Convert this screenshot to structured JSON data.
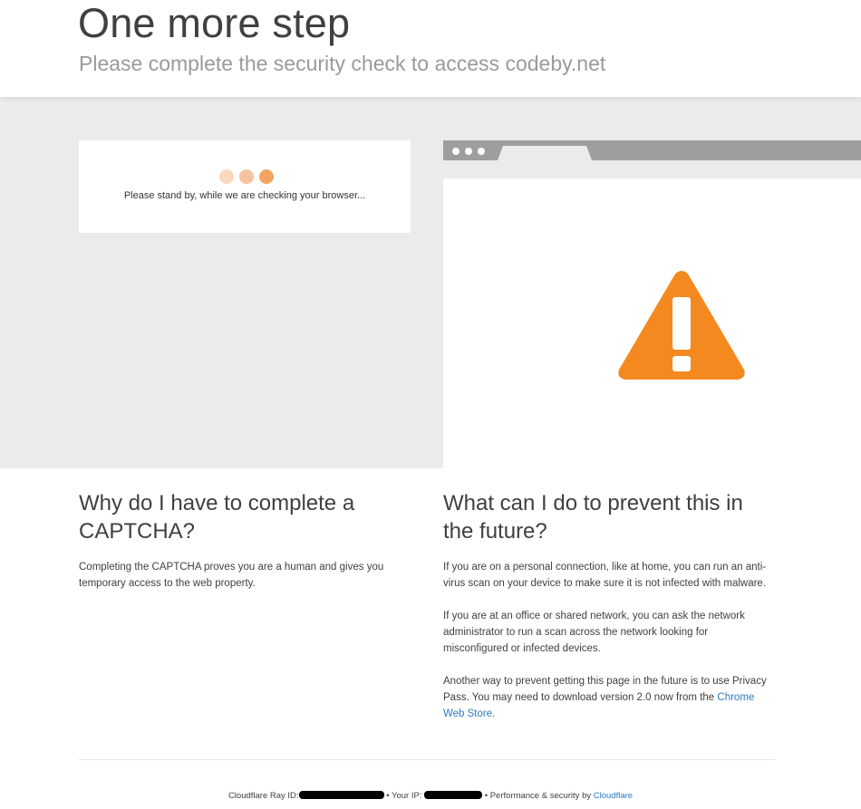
{
  "header": {
    "title": "One more step",
    "subtitle": "Please complete the security check to access codeby.net"
  },
  "check": {
    "message": "Please stand by, while we are checking your browser..."
  },
  "why": {
    "heading": "Why do I have to complete a CAPTCHA?",
    "body": "Completing the CAPTCHA proves you are a human and gives you temporary access to the web property."
  },
  "prevent": {
    "heading": "What can I do to prevent this in the future?",
    "p1": "If you are on a personal connection, like at home, you can run an anti-virus scan on your device to make sure it is not infected with malware.",
    "p2": "If you are at an office or shared network, you can ask the network administrator to run a scan across the network looking for misconfigured or infected devices.",
    "p3_before": "Another way to prevent getting this page in the future is to use Privacy Pass. You may need to download version 2.0 now from the ",
    "p3_link": "Chrome Web Store",
    "p3_after": "."
  },
  "footer": {
    "ray_label": "Cloudflare Ray ID:",
    "sep": "•",
    "ip_label": "Your IP:",
    "perf_label": "Performance & security by",
    "perf_link": "Cloudflare"
  },
  "colors": {
    "warning_orange": "#f48a1f",
    "link_blue": "#2f7bbf",
    "gray_band": "#ebebeb"
  },
  "icons": {
    "warning": "warning-triangle-icon",
    "loading": "loading-dots-icon"
  }
}
